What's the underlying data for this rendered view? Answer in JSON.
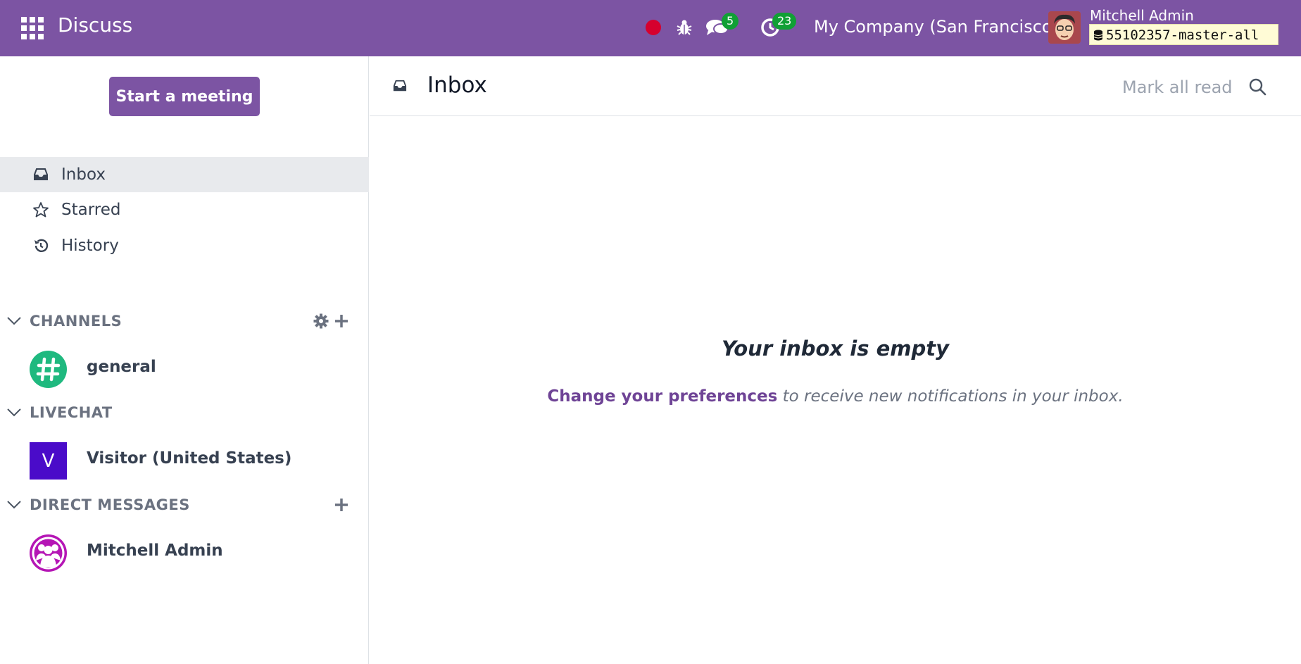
{
  "topbar": {
    "app_name": "Discuss",
    "messages_badge": "5",
    "activities_badge": "23",
    "company": "My Company (San Francisco)",
    "user_name": "Mitchell Admin",
    "database": "55102357-master-all",
    "brand_color": "#7c54a3"
  },
  "sidebar": {
    "start_meeting": "Start a meeting",
    "nav": [
      {
        "label": "Inbox",
        "icon": "inbox-icon",
        "active": true
      },
      {
        "label": "Starred",
        "icon": "star-icon"
      },
      {
        "label": "History",
        "icon": "history-icon"
      }
    ],
    "sections": [
      {
        "title": "CHANNELS",
        "items": [
          {
            "name": "general",
            "avatar": "#"
          }
        ]
      },
      {
        "title": "LIVECHAT",
        "items": [
          {
            "name": "Visitor (United States)",
            "avatar": "V"
          }
        ]
      },
      {
        "title": "DIRECT MESSAGES",
        "items": [
          {
            "name": "Mitchell Admin",
            "avatar": "group-icon"
          }
        ]
      }
    ]
  },
  "main": {
    "title": "Inbox",
    "mark_all_read": "Mark all read",
    "empty_title": "Your inbox is empty",
    "preferences_link": "Change your preferences",
    "empty_text": "to receive new notifications in your inbox."
  }
}
